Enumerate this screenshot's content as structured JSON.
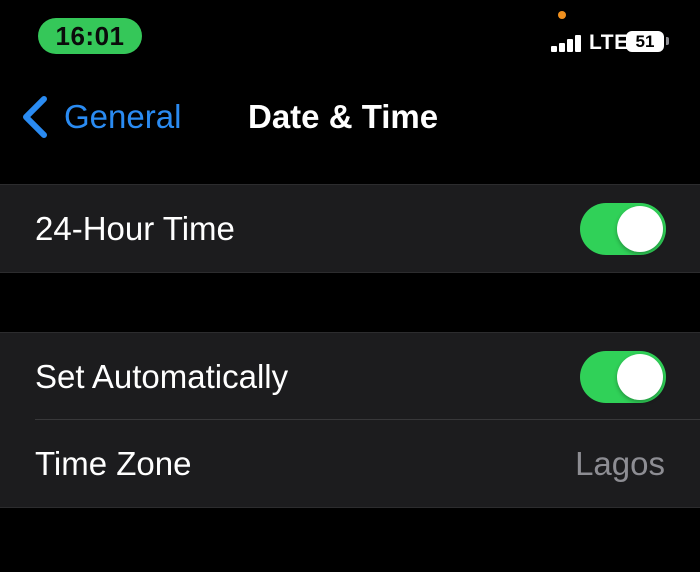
{
  "status_bar": {
    "time": "16:01",
    "network": "LTE",
    "battery_level": "51",
    "signal_bars": 4,
    "privacy_indicator_color": "#f0901e"
  },
  "nav": {
    "back_label": "General",
    "title": "Date & Time"
  },
  "groups": {
    "format": {
      "hour24_label": "24-Hour Time",
      "hour24_on": true
    },
    "time_settings": {
      "set_auto_label": "Set Automatically",
      "set_auto_on": true,
      "timezone_label": "Time Zone",
      "timezone_value": "Lagos"
    }
  },
  "colors": {
    "accent_blue": "#2a8bf2",
    "toggle_on": "#30d158",
    "status_time_bg": "#35c759",
    "background": "#000000",
    "cell_background": "#1c1c1e",
    "secondary_text": "#8d8d93"
  }
}
